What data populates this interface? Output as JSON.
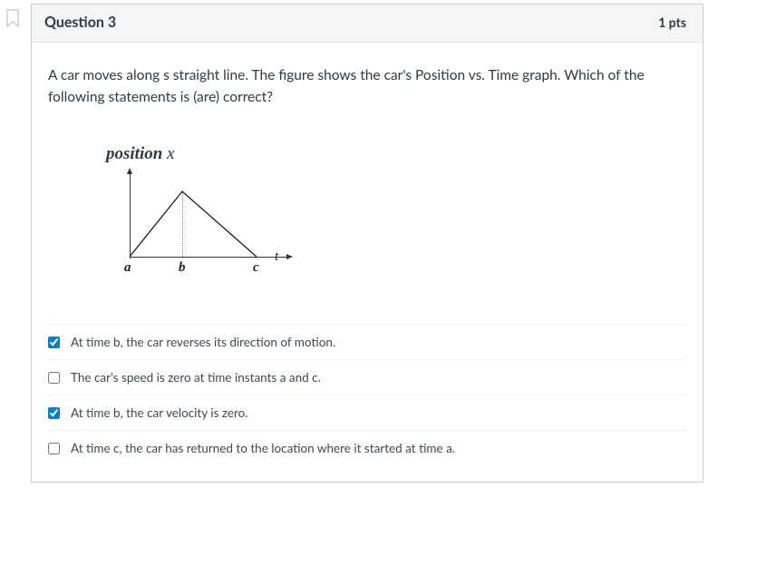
{
  "header": {
    "title": "Question 3",
    "points": "1 pts"
  },
  "prompt": "A car moves along s straight line. The figure shows the car's Position vs. Time graph. Which of the following statements is (are) correct?",
  "figure": {
    "ylabel_word": "position",
    "ylabel_var": "x",
    "xlabel_var": "t",
    "ticks": {
      "a": "a",
      "b": "b",
      "c": "c"
    }
  },
  "chart_data": {
    "type": "line",
    "title": "position x",
    "xlabel": "t",
    "ylabel": "position x",
    "categories": [
      "a",
      "b",
      "c"
    ],
    "series": [
      {
        "name": "position",
        "x": [
          0,
          58,
          140
        ],
        "y": [
          0,
          72,
          0
        ]
      }
    ],
    "xlim": [
      0,
      176
    ],
    "ylim": [
      0,
      98
    ],
    "annotations": [
      "a",
      "b",
      "c",
      "t"
    ]
  },
  "choices": [
    {
      "label": "At time b, the car reverses its direction of motion.",
      "checked": true
    },
    {
      "label": "The car's speed is zero at time instants a and c.",
      "checked": false
    },
    {
      "label": "At time b, the car velocity is zero.",
      "checked": true
    },
    {
      "label": "At time c, the car has returned to the location where it started at time a.",
      "checked": false
    }
  ]
}
